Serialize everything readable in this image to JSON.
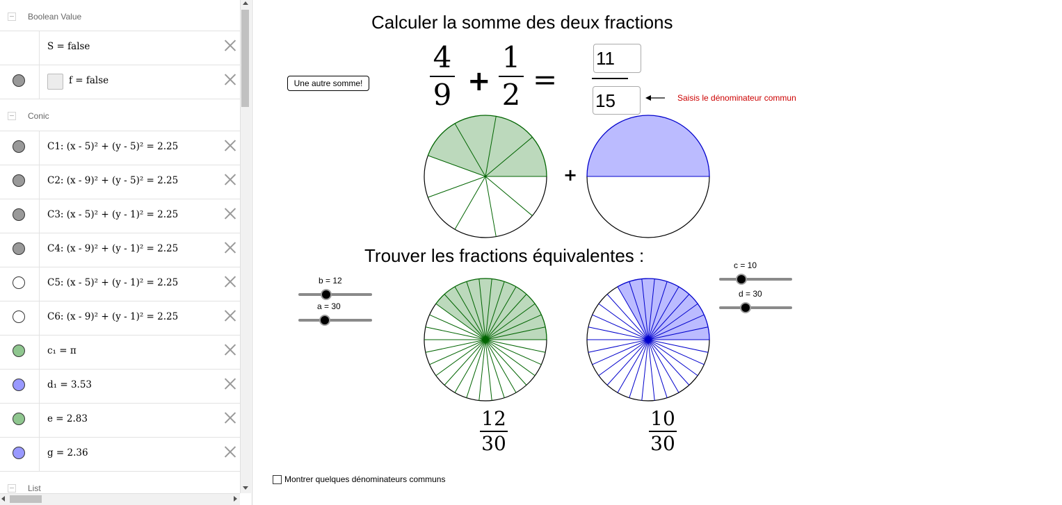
{
  "algebra": {
    "groups": [
      {
        "name": "Boolean Value",
        "items": [
          {
            "expr": "S = false",
            "marker": "none"
          },
          {
            "expr": "f = false",
            "marker": "gray",
            "checkbox": true
          }
        ]
      },
      {
        "name": "Conic",
        "items": [
          {
            "expr": "C1: (x - 5)² + (y - 5)² = 2.25",
            "marker": "gray"
          },
          {
            "expr": "C2: (x - 9)² + (y - 5)² = 2.25",
            "marker": "gray"
          },
          {
            "expr": "C3: (x - 5)² + (y - 1)² = 2.25",
            "marker": "gray"
          },
          {
            "expr": "C4: (x - 9)² + (y - 1)² = 2.25",
            "marker": "gray"
          },
          {
            "expr": "C5: (x - 5)² + (y - 1)² = 2.25",
            "marker": "white"
          },
          {
            "expr": "C6: (x - 9)² + (y - 1)² = 2.25",
            "marker": "white"
          },
          {
            "expr": "c₁ = π",
            "marker": "green"
          },
          {
            "expr": "d₁ = 3.53",
            "marker": "blue"
          },
          {
            "expr": "e = 2.83",
            "marker": "green"
          },
          {
            "expr": "g = 2.36",
            "marker": "blue"
          }
        ]
      },
      {
        "name": "List",
        "items": []
      }
    ],
    "marker_colors": {
      "gray": "#999999",
      "white": "#ffffff",
      "green": "#8fc68f",
      "blue": "#9999ff",
      "none": ""
    }
  },
  "graphics": {
    "title_top": "Calculer la somme des deux fractions",
    "title_mid": "Trouver les fractions équivalentes :",
    "button_label": "Une autre somme!",
    "frac1": {
      "num": "4",
      "den": "9"
    },
    "plus_sign": "+",
    "frac2": {
      "num": "1",
      "den": "2"
    },
    "equals_sign": "=",
    "answer_num": "11",
    "answer_den": "15",
    "hint": "Saisis le dénominateur commun",
    "pie_plus": "+",
    "sliders": {
      "b": {
        "label": "b = 12",
        "value": 12
      },
      "a": {
        "label": "a = 30",
        "value": 30
      },
      "c": {
        "label": "c = 10",
        "value": 10
      },
      "d": {
        "label": "d = 30",
        "value": 30
      }
    },
    "eq1": {
      "num": "12",
      "den": "30"
    },
    "eq2": {
      "num": "10",
      "den": "30"
    },
    "checkbox_label": "Montrer quelques dénominateurs communs",
    "colors": {
      "green_fill": "#bcd9bc",
      "green_line": "#006400",
      "blue_fill": "#bbbbff",
      "blue_line": "#0000cc",
      "hint_red": "#cc0000"
    }
  },
  "pies": [
    {
      "id": "top-left",
      "total": 9,
      "shaded": 4,
      "color": "green"
    },
    {
      "id": "top-right",
      "total": 2,
      "shaded": 1,
      "color": "blue"
    },
    {
      "id": "bottom-left",
      "total": 30,
      "shaded": 12,
      "color": "green"
    },
    {
      "id": "bottom-right",
      "total": 30,
      "shaded": 10,
      "color": "blue"
    }
  ]
}
